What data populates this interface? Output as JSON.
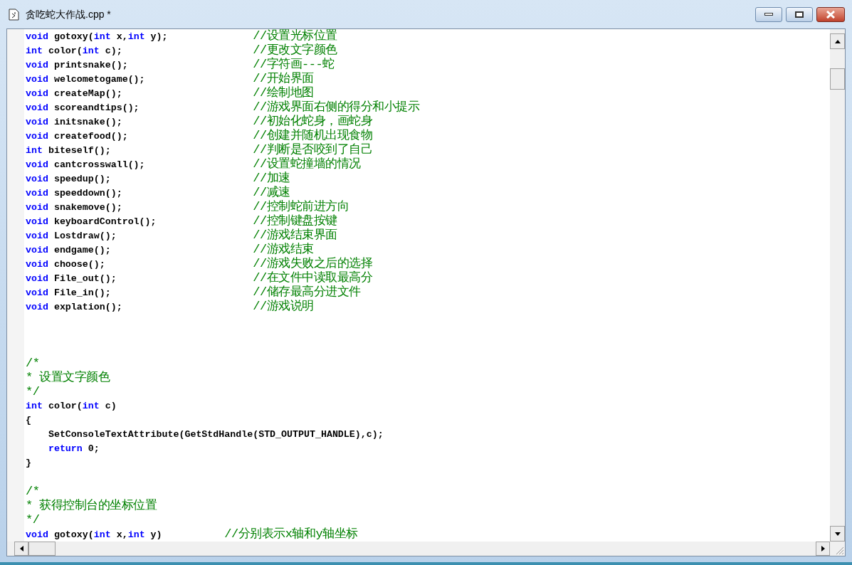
{
  "window": {
    "title": "贪吃蛇大作战.cpp *"
  },
  "lines": [
    {
      "kind": "code",
      "segments": [
        {
          "kind": "keyword",
          "text": "void"
        },
        {
          "kind": "plain",
          "text": " gotoxy("
        },
        {
          "kind": "keyword",
          "text": "int"
        },
        {
          "kind": "plain",
          "text": " x,"
        },
        {
          "kind": "keyword",
          "text": "int"
        },
        {
          "kind": "plain",
          "text": " y);               "
        },
        {
          "kind": "comment",
          "text": "//设置光标位置"
        }
      ]
    },
    {
      "kind": "code",
      "segments": [
        {
          "kind": "keyword",
          "text": "int"
        },
        {
          "kind": "plain",
          "text": " color("
        },
        {
          "kind": "keyword",
          "text": "int"
        },
        {
          "kind": "plain",
          "text": " c);                       "
        },
        {
          "kind": "comment",
          "text": "//更改文字颜色"
        }
      ]
    },
    {
      "kind": "code",
      "segments": [
        {
          "kind": "keyword",
          "text": "void"
        },
        {
          "kind": "plain",
          "text": " printsnake();                      "
        },
        {
          "kind": "comment",
          "text": "//字符画---蛇"
        }
      ]
    },
    {
      "kind": "code",
      "segments": [
        {
          "kind": "keyword",
          "text": "void"
        },
        {
          "kind": "plain",
          "text": " welcometogame();                   "
        },
        {
          "kind": "comment",
          "text": "//开始界面"
        }
      ]
    },
    {
      "kind": "code",
      "segments": [
        {
          "kind": "keyword",
          "text": "void"
        },
        {
          "kind": "plain",
          "text": " createMap();                       "
        },
        {
          "kind": "comment",
          "text": "//绘制地图"
        }
      ]
    },
    {
      "kind": "code",
      "segments": [
        {
          "kind": "keyword",
          "text": "void"
        },
        {
          "kind": "plain",
          "text": " scoreandtips();                    "
        },
        {
          "kind": "comment",
          "text": "//游戏界面右侧的得分和小提示"
        }
      ]
    },
    {
      "kind": "code",
      "segments": [
        {
          "kind": "keyword",
          "text": "void"
        },
        {
          "kind": "plain",
          "text": " initsnake();                       "
        },
        {
          "kind": "comment",
          "text": "//初始化蛇身，画蛇身"
        }
      ]
    },
    {
      "kind": "code",
      "segments": [
        {
          "kind": "keyword",
          "text": "void"
        },
        {
          "kind": "plain",
          "text": " createfood();                      "
        },
        {
          "kind": "comment",
          "text": "//创建并随机出现食物"
        }
      ]
    },
    {
      "kind": "code",
      "segments": [
        {
          "kind": "keyword",
          "text": "int"
        },
        {
          "kind": "plain",
          "text": " biteself();                         "
        },
        {
          "kind": "comment",
          "text": "//判断是否咬到了自己"
        }
      ]
    },
    {
      "kind": "code",
      "segments": [
        {
          "kind": "keyword",
          "text": "void"
        },
        {
          "kind": "plain",
          "text": " cantcrosswall();                   "
        },
        {
          "kind": "comment",
          "text": "//设置蛇撞墙的情况"
        }
      ]
    },
    {
      "kind": "code",
      "segments": [
        {
          "kind": "keyword",
          "text": "void"
        },
        {
          "kind": "plain",
          "text": " speedup();                         "
        },
        {
          "kind": "comment",
          "text": "//加速"
        }
      ]
    },
    {
      "kind": "code",
      "segments": [
        {
          "kind": "keyword",
          "text": "void"
        },
        {
          "kind": "plain",
          "text": " speeddown();                       "
        },
        {
          "kind": "comment",
          "text": "//减速"
        }
      ]
    },
    {
      "kind": "code",
      "segments": [
        {
          "kind": "keyword",
          "text": "void"
        },
        {
          "kind": "plain",
          "text": " snakemove();                       "
        },
        {
          "kind": "comment",
          "text": "//控制蛇前进方向"
        }
      ]
    },
    {
      "kind": "code",
      "segments": [
        {
          "kind": "keyword",
          "text": "void"
        },
        {
          "kind": "plain",
          "text": " keyboardControl();                 "
        },
        {
          "kind": "comment",
          "text": "//控制键盘按键"
        }
      ]
    },
    {
      "kind": "code",
      "segments": [
        {
          "kind": "keyword",
          "text": "void"
        },
        {
          "kind": "plain",
          "text": " Lostdraw();                        "
        },
        {
          "kind": "comment",
          "text": "//游戏结束界面"
        }
      ]
    },
    {
      "kind": "code",
      "segments": [
        {
          "kind": "keyword",
          "text": "void"
        },
        {
          "kind": "plain",
          "text": " endgame();                         "
        },
        {
          "kind": "comment",
          "text": "//游戏结束"
        }
      ]
    },
    {
      "kind": "code",
      "segments": [
        {
          "kind": "keyword",
          "text": "void"
        },
        {
          "kind": "plain",
          "text": " choose();                          "
        },
        {
          "kind": "comment",
          "text": "//游戏失败之后的选择"
        }
      ]
    },
    {
      "kind": "code",
      "segments": [
        {
          "kind": "keyword",
          "text": "void"
        },
        {
          "kind": "plain",
          "text": " File_out();                        "
        },
        {
          "kind": "comment",
          "text": "//在文件中读取最高分"
        }
      ]
    },
    {
      "kind": "code",
      "segments": [
        {
          "kind": "keyword",
          "text": "void"
        },
        {
          "kind": "plain",
          "text": " File_in();                         "
        },
        {
          "kind": "comment",
          "text": "//储存最高分进文件"
        }
      ]
    },
    {
      "kind": "code",
      "segments": [
        {
          "kind": "keyword",
          "text": "void"
        },
        {
          "kind": "plain",
          "text": " explation();                       "
        },
        {
          "kind": "comment",
          "text": "//游戏说明"
        }
      ]
    },
    {
      "kind": "blank"
    },
    {
      "kind": "blank"
    },
    {
      "kind": "blank"
    },
    {
      "kind": "code",
      "segments": [
        {
          "kind": "comment",
          "text": "/*"
        }
      ]
    },
    {
      "kind": "code",
      "segments": [
        {
          "kind": "comment",
          "text": "* 设置文字颜色"
        }
      ]
    },
    {
      "kind": "code",
      "segments": [
        {
          "kind": "comment",
          "text": "*/"
        }
      ]
    },
    {
      "kind": "code",
      "segments": [
        {
          "kind": "keyword",
          "text": "int"
        },
        {
          "kind": "plain",
          "text": " color("
        },
        {
          "kind": "keyword",
          "text": "int"
        },
        {
          "kind": "plain",
          "text": " c)"
        }
      ]
    },
    {
      "kind": "code",
      "segments": [
        {
          "kind": "plain",
          "text": "{"
        }
      ]
    },
    {
      "kind": "code",
      "segments": [
        {
          "kind": "plain",
          "text": "    SetConsoleTextAttribute(GetStdHandle(STD_OUTPUT_HANDLE),c);"
        }
      ]
    },
    {
      "kind": "code",
      "segments": [
        {
          "kind": "keyword",
          "text": "    return"
        },
        {
          "kind": "plain",
          "text": " 0;"
        }
      ]
    },
    {
      "kind": "code",
      "segments": [
        {
          "kind": "plain",
          "text": "}"
        }
      ]
    },
    {
      "kind": "blank"
    },
    {
      "kind": "code",
      "segments": [
        {
          "kind": "comment",
          "text": "/*"
        }
      ]
    },
    {
      "kind": "code",
      "segments": [
        {
          "kind": "comment",
          "text": "* 获得控制台的坐标位置"
        }
      ]
    },
    {
      "kind": "code",
      "segments": [
        {
          "kind": "comment",
          "text": "*/"
        }
      ]
    },
    {
      "kind": "code",
      "segments": [
        {
          "kind": "keyword",
          "text": "void"
        },
        {
          "kind": "plain",
          "text": " gotoxy("
        },
        {
          "kind": "keyword",
          "text": "int"
        },
        {
          "kind": "plain",
          "text": " x,"
        },
        {
          "kind": "keyword",
          "text": "int"
        },
        {
          "kind": "plain",
          "text": " y)           "
        },
        {
          "kind": "comment",
          "text": "//分别表示x轴和y轴坐标"
        }
      ]
    }
  ]
}
